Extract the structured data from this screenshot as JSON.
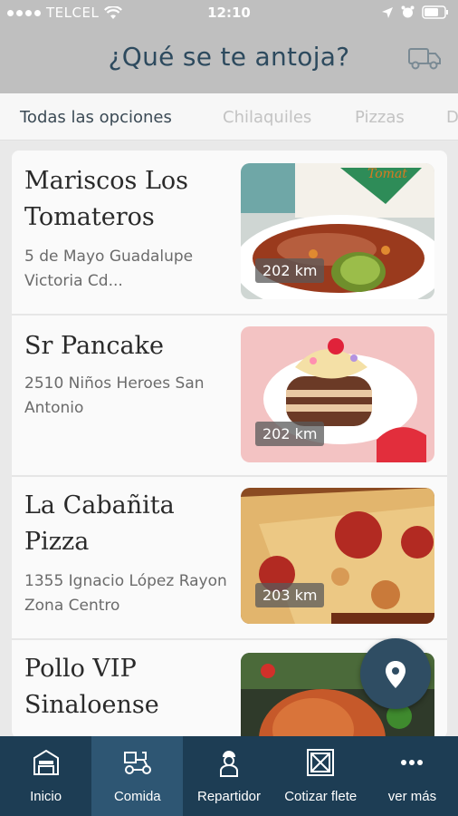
{
  "status_bar": {
    "carrier": "TELCEL",
    "time": "12:10"
  },
  "header": {
    "title": "¿Qué se te antoja?",
    "truck_icon": "delivery-truck-icon"
  },
  "tabs": [
    {
      "label": "Todas las opciones",
      "active": true
    },
    {
      "label": "Chilaquiles",
      "active": false
    },
    {
      "label": "Pizzas",
      "active": false
    },
    {
      "label": "D",
      "active": false
    }
  ],
  "restaurants": [
    {
      "name": "Mariscos Los Tomateros",
      "address": "5 de Mayo Guadalupe Victoria Cd...",
      "distance": "202 km"
    },
    {
      "name": "Sr Pancake",
      "address": "2510 Niños Heroes San Antonio",
      "distance": "202 km"
    },
    {
      "name": "La Cabañita Pizza",
      "address": "1355 Ignacio López Rayon Zona Centro",
      "distance": "203 km"
    },
    {
      "name": "Pollo VIP Sinaloense",
      "address": "",
      "distance": ""
    }
  ],
  "fab": {
    "icon": "map-pin-icon"
  },
  "bottom_nav": [
    {
      "label": "Inicio",
      "icon": "store-icon",
      "active": false
    },
    {
      "label": "Comida",
      "icon": "delivery-scooter-icon",
      "active": true
    },
    {
      "label": "Repartidor",
      "icon": "courier-icon",
      "active": false
    },
    {
      "label": "Cotizar flete",
      "icon": "crate-icon",
      "active": false
    },
    {
      "label": "ver más",
      "icon": "more-icon",
      "active": false
    }
  ],
  "colors": {
    "header_bg": "#bfbfbf",
    "title": "#2d4a5e",
    "nav_bg": "#1d3d54",
    "nav_active": "#2e5673",
    "fab": "#2f4d63"
  }
}
